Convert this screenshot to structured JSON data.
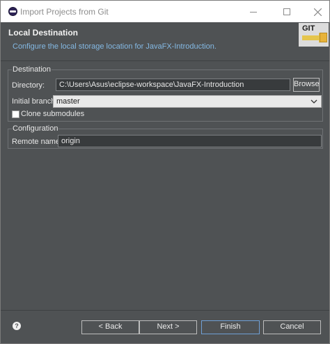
{
  "window": {
    "title": "Import Projects from Git",
    "icons": {
      "app": "eclipse-icon",
      "minimize": "minimize-icon",
      "maximize": "maximize-icon",
      "close": "close-icon"
    }
  },
  "header": {
    "title": "Local Destination",
    "description": "Configure the local storage location for JavaFX-Introduction.",
    "banner_text": "GIT",
    "banner_icon": "git-import-banner-icon"
  },
  "destination": {
    "group_label": "Destination",
    "directory_label": "Directory:",
    "directory_value": "C:\\Users\\Asus\\eclipse-workspace\\JavaFX-Introduction",
    "browse_label": "Browse",
    "initial_branch_label": "Initial branch:",
    "initial_branch_value": "master",
    "clone_submodules_label": "Clone submodules",
    "clone_submodules_checked": false
  },
  "configuration": {
    "group_label": "Configuration",
    "remote_name_label": "Remote name:",
    "remote_name_value": "origin"
  },
  "footer": {
    "help_icon": "help-icon",
    "back_label": "< Back",
    "next_label": "Next >",
    "finish_label": "Finish",
    "cancel_label": "Cancel"
  },
  "colors": {
    "background": "#4f5254",
    "description_text": "#84b9e4",
    "finish_border": "#70a0d6"
  }
}
